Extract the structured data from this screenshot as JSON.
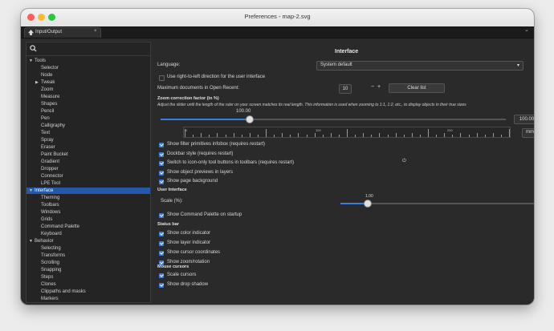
{
  "window": {
    "title": "Preferences - map-2.svg"
  },
  "tab": {
    "label": "Input/Output",
    "close": "×",
    "menu_chevron": "⌄"
  },
  "sidebar": {
    "search_placeholder": "",
    "items": [
      {
        "label": "Tools",
        "level": 0,
        "expand": "▼",
        "selected": false
      },
      {
        "label": "Selector",
        "level": 1,
        "expand": "",
        "selected": false
      },
      {
        "label": "Node",
        "level": 1,
        "expand": "",
        "selected": false
      },
      {
        "label": "Tweak",
        "level": 1,
        "expand": "▶",
        "selected": false
      },
      {
        "label": "Zoom",
        "level": 1,
        "expand": "",
        "selected": false
      },
      {
        "label": "Measure",
        "level": 1,
        "expand": "",
        "selected": false
      },
      {
        "label": "Shapes",
        "level": 1,
        "expand": "",
        "selected": false
      },
      {
        "label": "Pencil",
        "level": 1,
        "expand": "",
        "selected": false
      },
      {
        "label": "Pen",
        "level": 1,
        "expand": "",
        "selected": false
      },
      {
        "label": "Calligraphy",
        "level": 1,
        "expand": "",
        "selected": false
      },
      {
        "label": "Text",
        "level": 1,
        "expand": "",
        "selected": false
      },
      {
        "label": "Spray",
        "level": 1,
        "expand": "",
        "selected": false
      },
      {
        "label": "Eraser",
        "level": 1,
        "expand": "",
        "selected": false
      },
      {
        "label": "Paint Bucket",
        "level": 1,
        "expand": "",
        "selected": false
      },
      {
        "label": "Gradient",
        "level": 1,
        "expand": "",
        "selected": false
      },
      {
        "label": "Dropper",
        "level": 1,
        "expand": "",
        "selected": false
      },
      {
        "label": "Connector",
        "level": 1,
        "expand": "",
        "selected": false
      },
      {
        "label": "LPE Tool",
        "level": 1,
        "expand": "",
        "selected": false
      },
      {
        "label": "Interface",
        "level": 0,
        "expand": "▼",
        "selected": true
      },
      {
        "label": "Theming",
        "level": 1,
        "expand": "",
        "selected": false
      },
      {
        "label": "Toolbars",
        "level": 1,
        "expand": "",
        "selected": false
      },
      {
        "label": "Windows",
        "level": 1,
        "expand": "",
        "selected": false
      },
      {
        "label": "Grids",
        "level": 1,
        "expand": "",
        "selected": false
      },
      {
        "label": "Command Palette",
        "level": 1,
        "expand": "",
        "selected": false
      },
      {
        "label": "Keyboard",
        "level": 1,
        "expand": "",
        "selected": false
      },
      {
        "label": "Behavior",
        "level": 0,
        "expand": "▼",
        "selected": false
      },
      {
        "label": "Selecting",
        "level": 1,
        "expand": "",
        "selected": false
      },
      {
        "label": "Transforms",
        "level": 1,
        "expand": "",
        "selected": false
      },
      {
        "label": "Scrolling",
        "level": 1,
        "expand": "",
        "selected": false
      },
      {
        "label": "Snapping",
        "level": 1,
        "expand": "",
        "selected": false
      },
      {
        "label": "Steps",
        "level": 1,
        "expand": "",
        "selected": false
      },
      {
        "label": "Clones",
        "level": 1,
        "expand": "",
        "selected": false
      },
      {
        "label": "Clippaths and masks",
        "level": 1,
        "expand": "",
        "selected": false
      },
      {
        "label": "Markers",
        "level": 1,
        "expand": "",
        "selected": false
      }
    ]
  },
  "main": {
    "heading": "Interface",
    "language_label": "Language:",
    "language_value": "System default",
    "language_chevron": "▾",
    "rtl_label": "Use right-to-left direction for the user interface",
    "recent_label": "Maximum documents in Open Recent:",
    "recent_value": "10",
    "recent_minus": "−",
    "recent_plus": "+",
    "recent_clear": "Clear list",
    "zoom_title": "Zoom correction factor (in %)",
    "zoom_desc": "Adjust the slider until the length of the ruler on your screen matches its real length. This information is used when zooming to 1:1, 1:2, etc., to display objects in their true sizes",
    "zoom_value_label": "100.00",
    "zoom_field": "100.00",
    "zoom_minus": "−",
    "ruler_labels": [
      "0",
      "100",
      "200"
    ],
    "ruler_unit": "mm",
    "ruler_unit_chevron": "▾",
    "interface_checks": [
      {
        "label": "Show filter primitives infobox (requires restart)",
        "checked": true
      },
      {
        "label": "Dockbar style (requires restart)",
        "checked": true
      },
      {
        "label": "Switch to icon-only tool buttons in toolbars (requires restart)",
        "checked": true
      },
      {
        "label": "Show object previews in layers",
        "checked": true
      },
      {
        "label": "Show page background",
        "checked": true
      }
    ],
    "reset_icon": "⏻",
    "ui_section": "User Interface",
    "ui_scale_label": "Scale (%):",
    "ui_scale_value": "1.00",
    "ui_scale_checked_label": "Show Command Palette on startup",
    "statusbar_section": "Status bar",
    "statusbar_checks": [
      {
        "label": "Show color indicator",
        "checked": true
      },
      {
        "label": "Show layer indicator",
        "checked": true
      },
      {
        "label": "Show cursor coordinates",
        "checked": true
      },
      {
        "label": "Show zoom/rotation",
        "checked": true
      }
    ],
    "mouse_section": "Mouse cursors",
    "mouse_checks": [
      {
        "label": "Scale cursors",
        "checked": true
      },
      {
        "label": "Show drop shadow",
        "checked": true
      }
    ]
  },
  "colors": {
    "accent": "#3b7ddd",
    "selection": "#2459a9",
    "bg": "#2a2a2a"
  }
}
